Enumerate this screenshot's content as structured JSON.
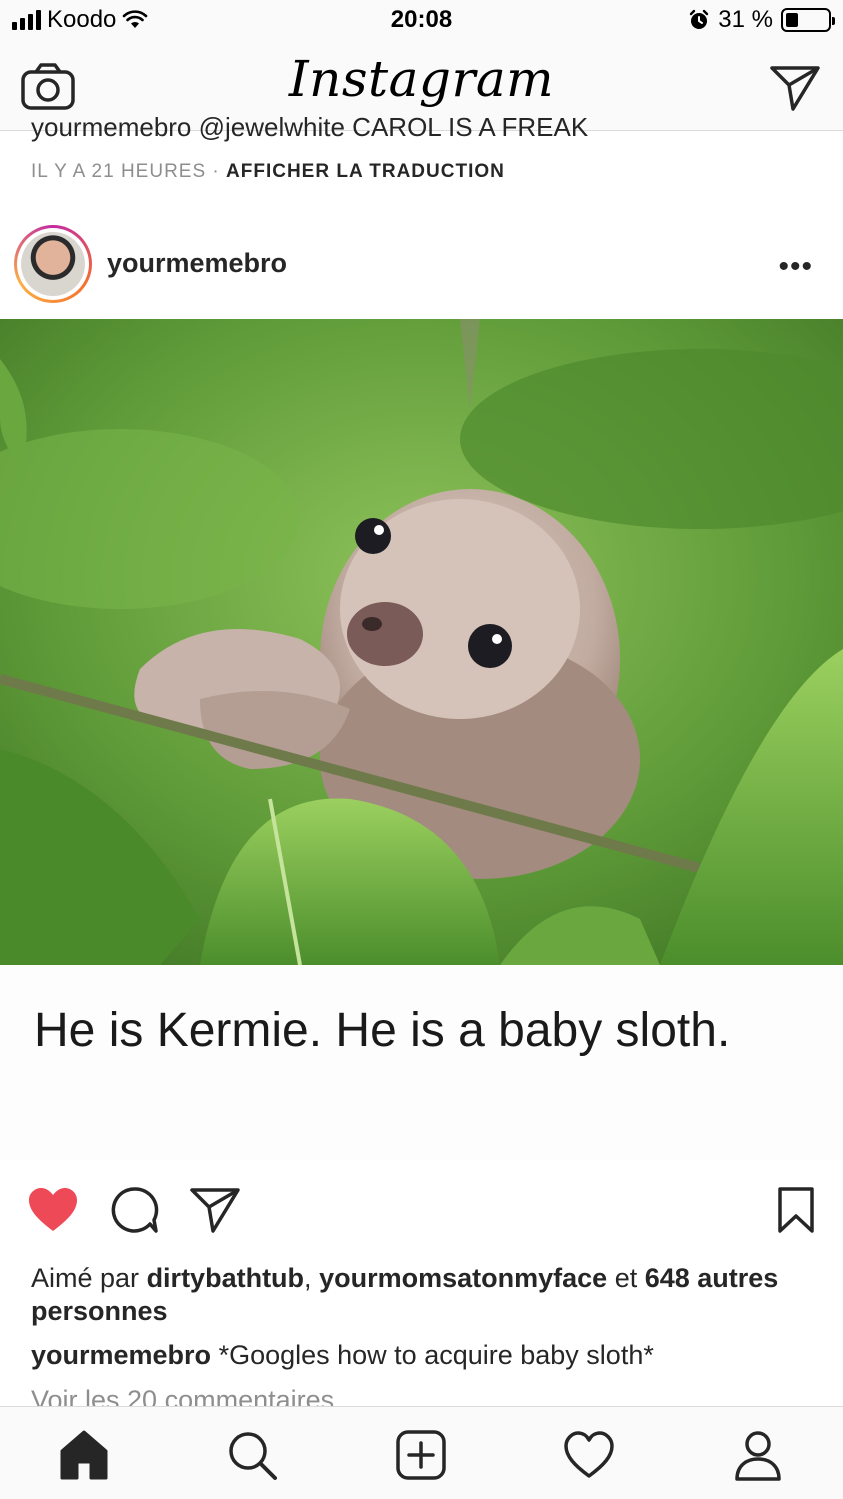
{
  "status_bar": {
    "carrier": "Koodo",
    "time": "20:08",
    "battery_percent": "31 %",
    "battery_level": 0.31
  },
  "nav": {
    "title": "Instagram",
    "left_icon": "camera-icon",
    "right_icon": "direct-message-icon"
  },
  "previous_post": {
    "caption_partial": "yourmemebro @jewelwhite CAROL IS A FREAK",
    "time_ago": "IL Y A 21 HEURES",
    "separator": "·",
    "translate_link": "AFFICHER LA TRADUCTION"
  },
  "post": {
    "username": "yourmemebro",
    "more_label": "•••",
    "image_caption": "He is Kermie. He is a baby sloth.",
    "liked": true,
    "like_color": "#ed4956",
    "likes": {
      "prefix": "Aimé par",
      "user1": "dirtybathtub",
      "comma": ",",
      "user2": "yourmomsatonmyface",
      "conj": "et",
      "others": "648 autres personnes"
    },
    "caption": {
      "username": "yourmemebro",
      "text": "*Googles how to acquire baby sloth*"
    },
    "comments_link": "Voir les 20 commentaires"
  },
  "tab_bar": {
    "items": [
      "home-icon",
      "search-icon",
      "new-post-icon",
      "activity-icon",
      "profile-icon"
    ]
  }
}
